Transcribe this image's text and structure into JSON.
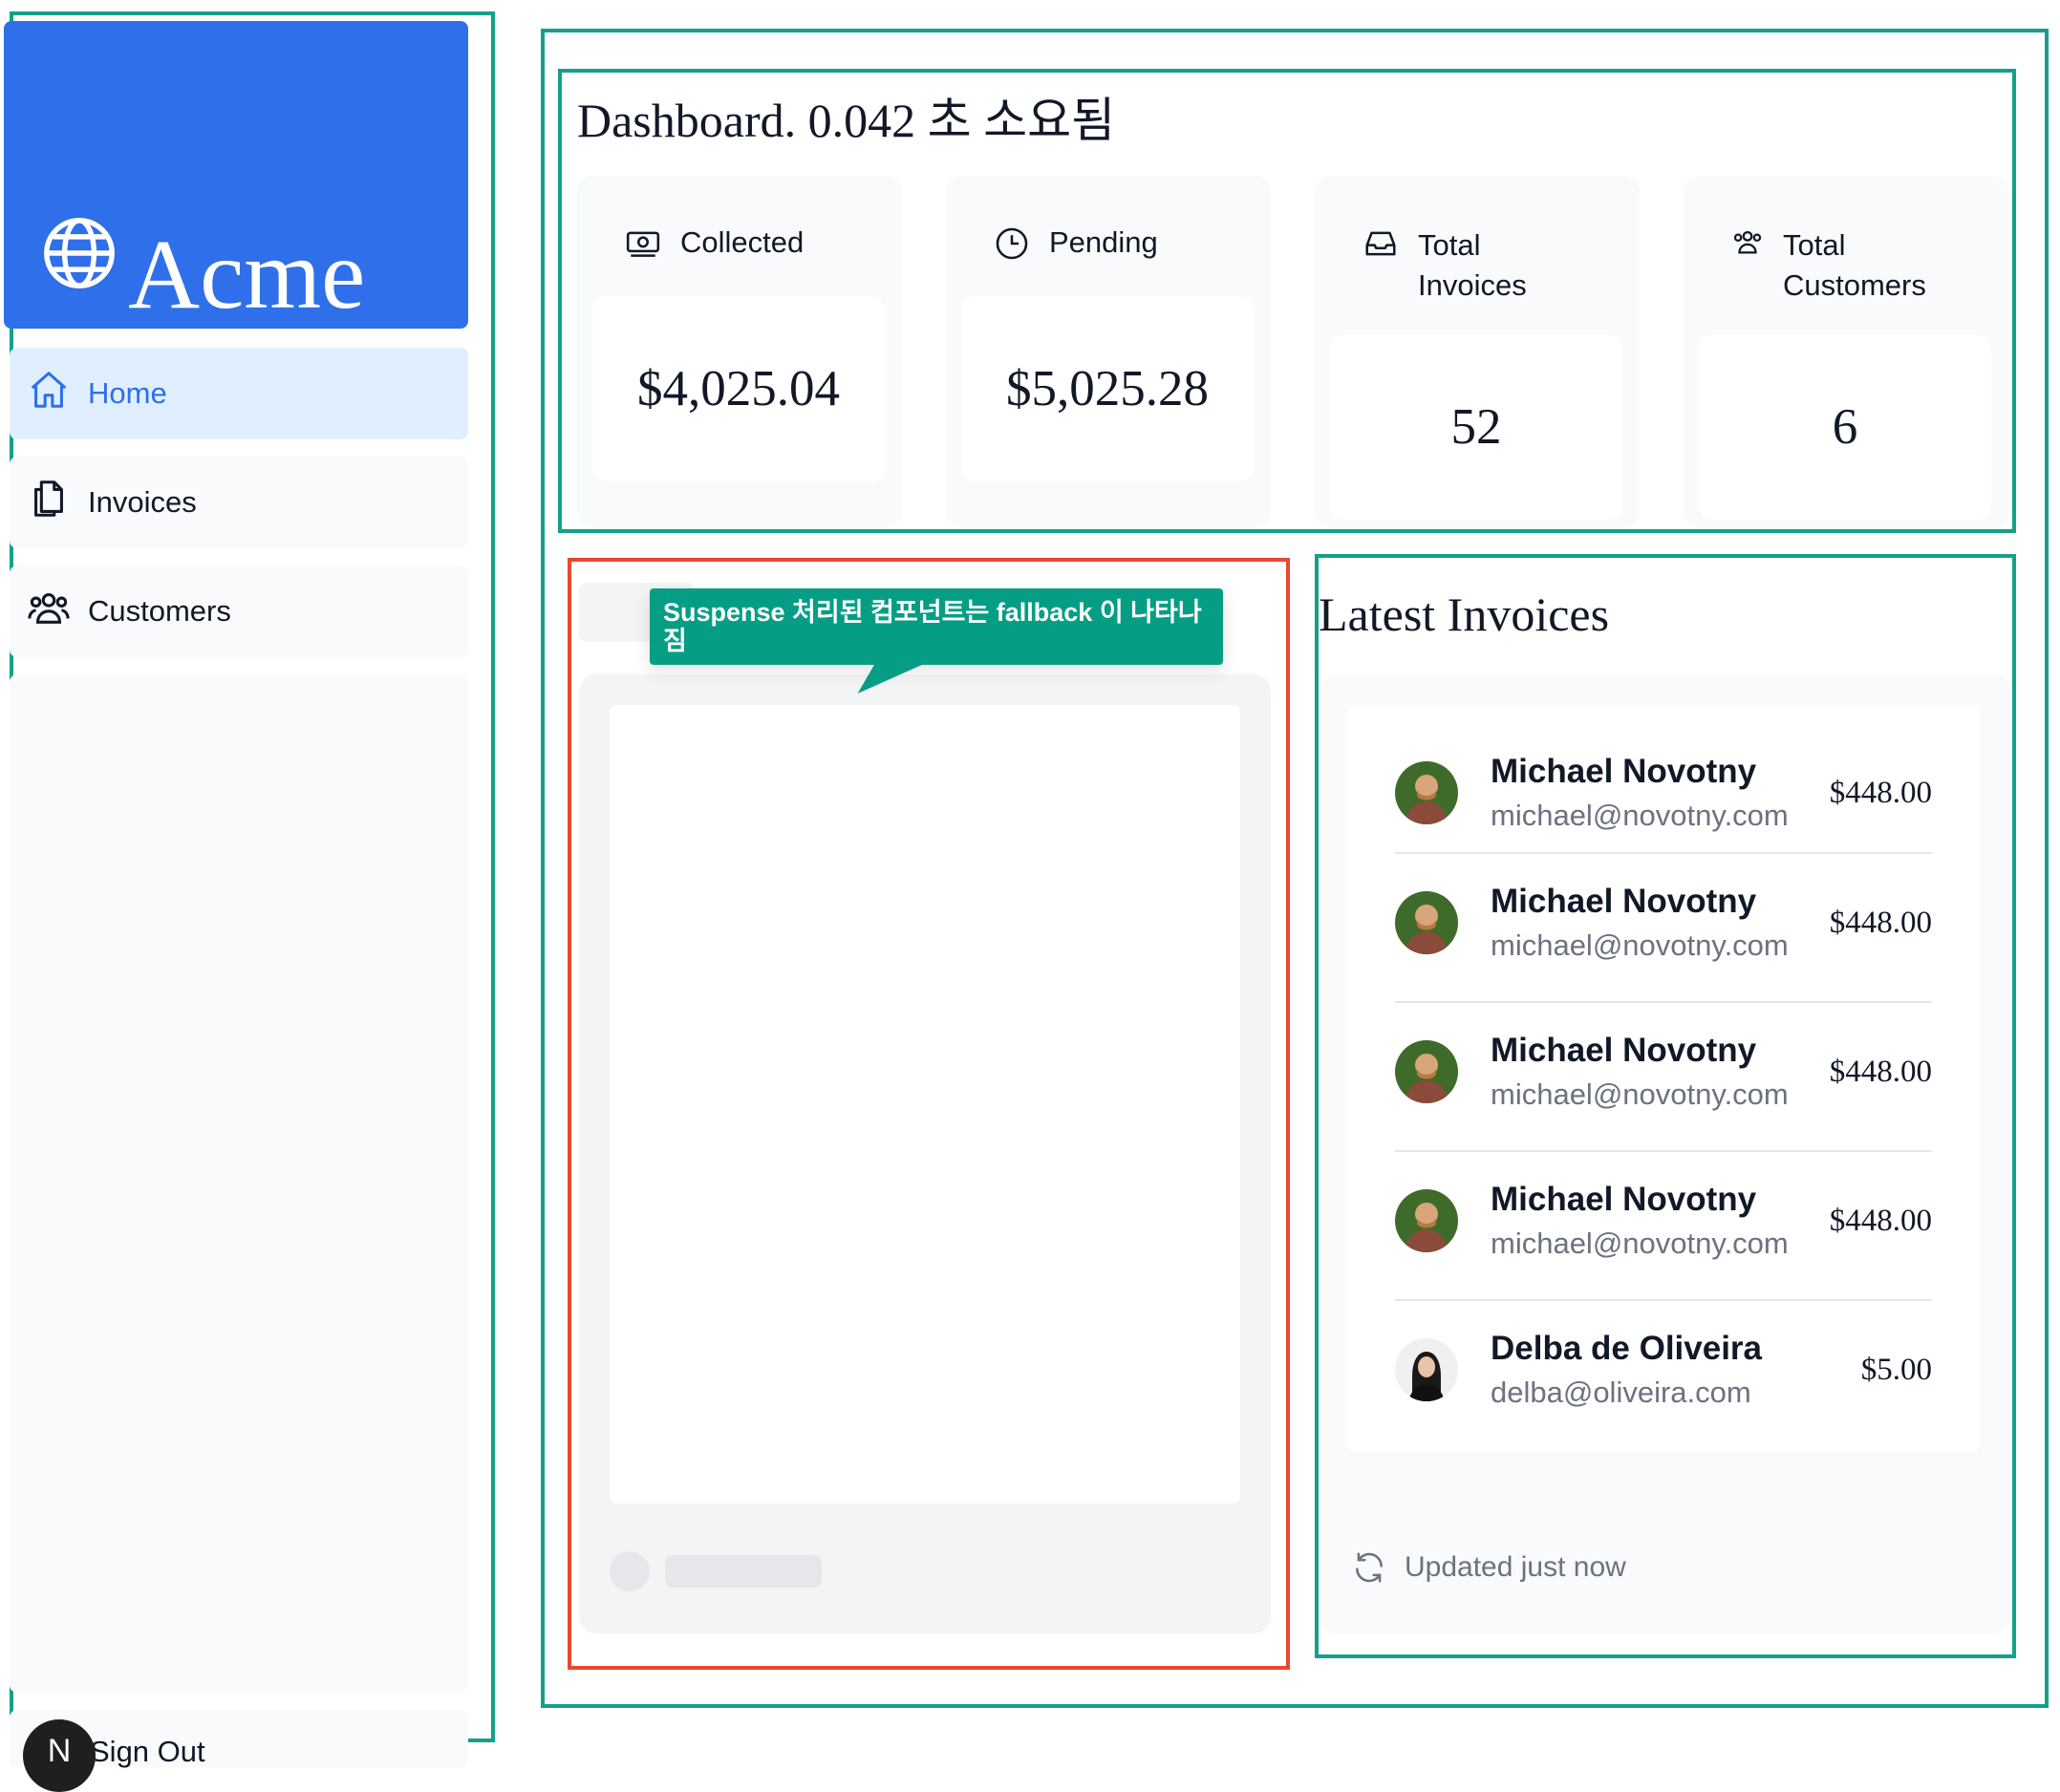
{
  "sidebar": {
    "logo": "Acme",
    "nav": [
      {
        "label": "Home",
        "icon": "home-icon",
        "active": true
      },
      {
        "label": "Invoices",
        "icon": "document-duplicate-icon",
        "active": false
      },
      {
        "label": "Customers",
        "icon": "user-group-icon",
        "active": false
      }
    ],
    "sign_out": "Sign Out",
    "badge": "N"
  },
  "dashboard": {
    "title": "Dashboard. 0.042 초 소요됨",
    "cards": [
      {
        "label": "Collected",
        "icon": "banknotes-icon",
        "value": "$4,025.04"
      },
      {
        "label": "Pending",
        "icon": "clock-icon",
        "value": "$5,025.28"
      },
      {
        "label_line1": "Total",
        "label_line2": "Invoices",
        "icon": "inbox-icon",
        "value": "52"
      },
      {
        "label_line1": "Total",
        "label_line2": "Customers",
        "icon": "user-group-icon",
        "value": "6"
      }
    ]
  },
  "tooltip": {
    "text": "Suspense 처리된 컴포넌트는 fallback 이 나타나짐"
  },
  "latest_invoices": {
    "title": "Latest Invoices",
    "rows": [
      {
        "name": "Michael Novotny",
        "email": "michael@novotny.com",
        "amount": "$448.00"
      },
      {
        "name": "Michael Novotny",
        "email": "michael@novotny.com",
        "amount": "$448.00"
      },
      {
        "name": "Michael Novotny",
        "email": "michael@novotny.com",
        "amount": "$448.00"
      },
      {
        "name": "Michael Novotny",
        "email": "michael@novotny.com",
        "amount": "$448.00"
      },
      {
        "name": "Delba de Oliveira",
        "email": "delba@oliveira.com",
        "amount": "$5.00"
      }
    ],
    "updated": "Updated just now"
  },
  "colors": {
    "brand_blue": "#2f6fea",
    "outline_green": "#14a08a",
    "outline_red": "#e8482f",
    "tooltip_green": "#059e84"
  }
}
